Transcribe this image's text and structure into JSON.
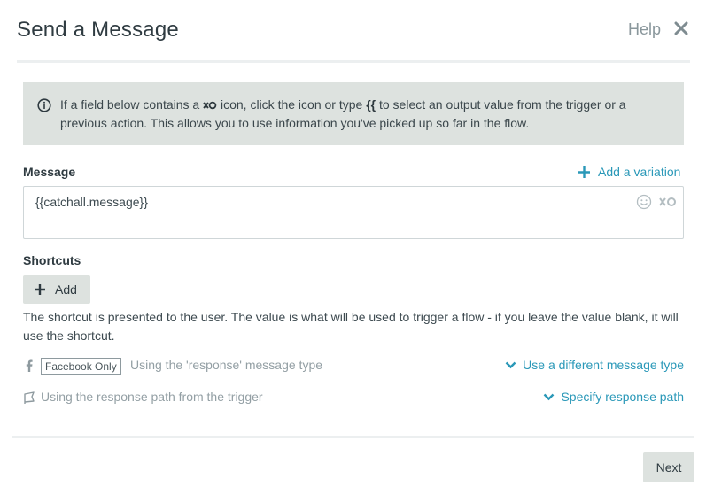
{
  "dialog": {
    "title": "Send a Message",
    "help_label": "Help"
  },
  "info": {
    "text_before_icon": "If a field below contains a",
    "text_after_icon": "icon, click the icon or type",
    "braces": "{{",
    "text_after_braces": "to select an output value from the trigger or a previous action. This allows you to use information you've picked up so far in the flow."
  },
  "message": {
    "label": "Message",
    "add_variation_label": "Add a variation",
    "value": "{{catchall.message}}"
  },
  "shortcuts": {
    "label": "Shortcuts",
    "add_label": "Add",
    "description": "The shortcut is presented to the user. The value is what will be used to trigger a flow - if you leave the value blank, it will use the shortcut."
  },
  "message_type": {
    "badge": "Facebook Only",
    "text": "Using the 'response' message type",
    "link_label": "Use a different message type"
  },
  "response_path": {
    "text": "Using the response path from the trigger",
    "link_label": "Specify response path"
  },
  "footer": {
    "next_label": "Next"
  },
  "colors": {
    "accent": "#2a98b8",
    "panel": "#dde2df",
    "muted_text": "#939fa4"
  }
}
